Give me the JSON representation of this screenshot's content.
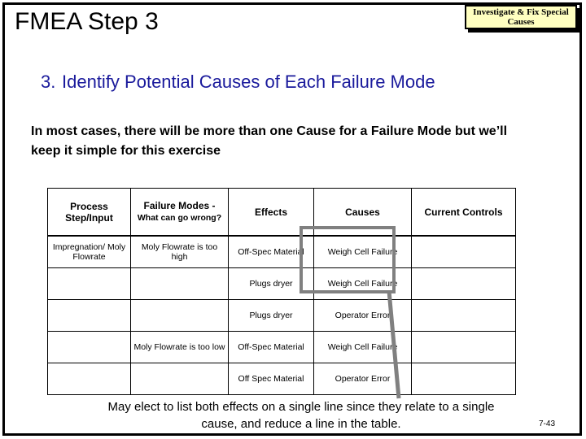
{
  "slide": {
    "title": "FMEA Step 3",
    "badge_text": "Investigate & Fix Special Causes",
    "badge_bg": "#ffffc0",
    "heading_number": "3.",
    "heading_text": "Identify Potential Causes of Each Failure Mode",
    "heading_color": "#1a1a9c",
    "subtext": "In most cases, there will be more than one Cause for a Failure Mode but we’ll keep it simple for this exercise",
    "caption": "May elect to list both effects on a single line since they relate to a single cause, and reduce a line in the table.",
    "page_number": "7-43",
    "highlight_color": "#808080"
  },
  "table": {
    "headers": [
      {
        "main": "Process Step/Input",
        "sub": ""
      },
      {
        "main": "Failure Modes -",
        "sub": "What can go wrong?"
      },
      {
        "main": "Effects",
        "sub": ""
      },
      {
        "main": "Causes",
        "sub": ""
      },
      {
        "main": "Current Controls",
        "sub": ""
      }
    ],
    "rows": [
      {
        "process_step": "Impregnation/ Moly Flowrate",
        "failure_mode": "Moly Flowrate is too high",
        "effect": "Off-Spec Material",
        "cause": "Weigh Cell Failure",
        "control": ""
      },
      {
        "process_step": "",
        "failure_mode": "",
        "effect": "Plugs dryer",
        "cause": "Weigh Cell Failure",
        "control": ""
      },
      {
        "process_step": "",
        "failure_mode": "",
        "effect": "Plugs dryer",
        "cause": "Operator Error",
        "control": ""
      },
      {
        "process_step": "",
        "failure_mode": "Moly Flowrate is too low",
        "effect": "Off-Spec Material",
        "cause": "Weigh Cell Failure",
        "control": ""
      },
      {
        "process_step": "",
        "failure_mode": "",
        "effect": "Off Spec Material",
        "cause": "Operator Error",
        "control": ""
      }
    ]
  }
}
